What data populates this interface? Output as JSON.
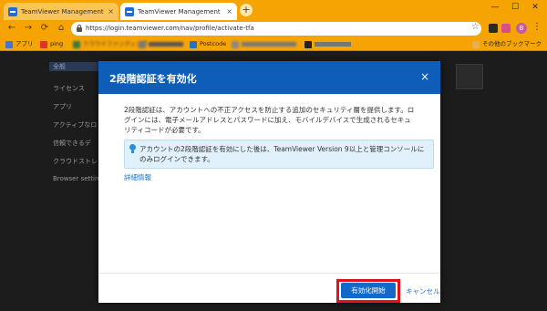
{
  "browser": {
    "tabs": [
      {
        "title": "TeamViewer Management Conso",
        "close": "×"
      },
      {
        "title": "TeamViewer Management Conso",
        "close": "×"
      }
    ],
    "new_tab": "+",
    "window_controls": {
      "minimize": "—",
      "maximize": "☐",
      "close": "✕"
    },
    "url": "https://login.teamviewer.com/nav/profile/activate-tfa",
    "avatar_letter": "B"
  },
  "bookmarks": [
    {
      "label": "アプリ",
      "color": "#4a74c9"
    },
    {
      "label": "ping",
      "color": "#e2322f"
    },
    {
      "label": "クラウドファンディング",
      "color": "#3d7a3d"
    },
    {
      "label": "",
      "color": "#7a7a7a"
    },
    {
      "label": "Postcode",
      "color": "#2f6fba"
    },
    {
      "label": "",
      "color": "#888888"
    },
    {
      "label": "",
      "color": "#222222"
    },
    {
      "label": "その他のブックマーク",
      "color": "#e8b04a"
    }
  ],
  "sidebar": {
    "items": [
      "全般",
      "ライセンス",
      "アプリ",
      "アクティブなロ",
      "信頼できるデ",
      "クラウドストレ",
      "Browser settings"
    ]
  },
  "modal": {
    "title": "2段階認証を有効化",
    "close": "×",
    "description": "2段階認証は、アカウントへの不正アクセスを防止する追加のセキュリティ層を提供します。ログインには、電子メールアドレスとパスワードに加え、モバイルデバイスで生成されるセキュリティコードが必要です。",
    "info": "アカウントの2段階認証を有効にした後は、TeamViewer Version 9以上と管理コンソールにのみログインできます。",
    "details_link": "詳細情報",
    "enable_button": "有効化開始",
    "cancel_link": "キャンセル"
  },
  "colors": {
    "chrome": "#f6a404",
    "modal_header": "#0e5db8",
    "primary_button": "#1269c8",
    "highlight": "#e2121b"
  }
}
